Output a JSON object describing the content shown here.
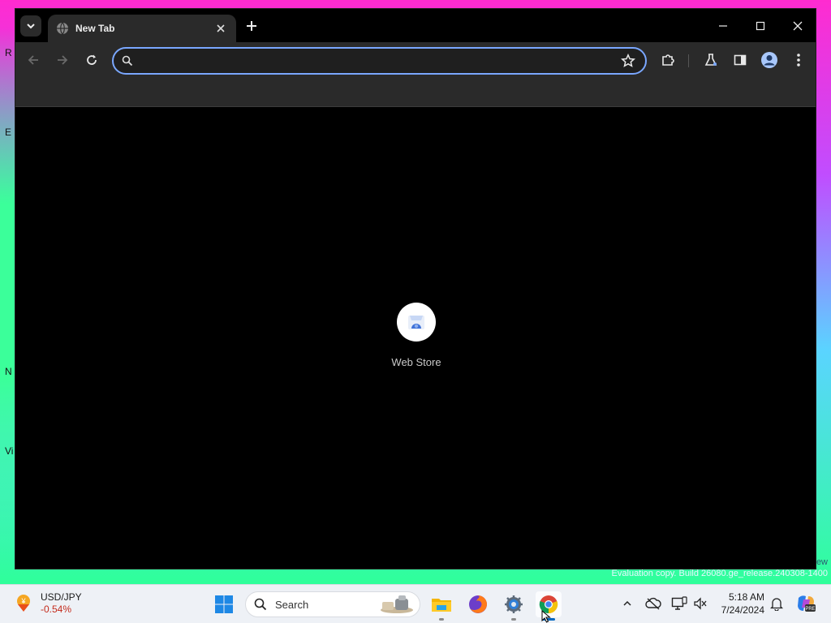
{
  "desktop": {
    "edge_letters": [
      "R",
      "E",
      "N",
      "Vi"
    ],
    "watermark_suffix": "ew",
    "watermark": "Evaluation copy. Build 26080.ge_release.240308-1400"
  },
  "browser": {
    "tab": {
      "title": "New Tab"
    },
    "omnibox": {
      "value": "",
      "placeholder": ""
    },
    "shortcut": {
      "label": "Web Store"
    },
    "colors": {
      "omnibox_border": "#7aa7ff",
      "toolbar": "#2a2a2a",
      "content": "#000000"
    }
  },
  "taskbar": {
    "widget": {
      "symbol": "USD/JPY",
      "change": "-0.54%"
    },
    "search_label": "Search",
    "clock": {
      "time": "5:18 AM",
      "date": "7/24/2024"
    }
  }
}
